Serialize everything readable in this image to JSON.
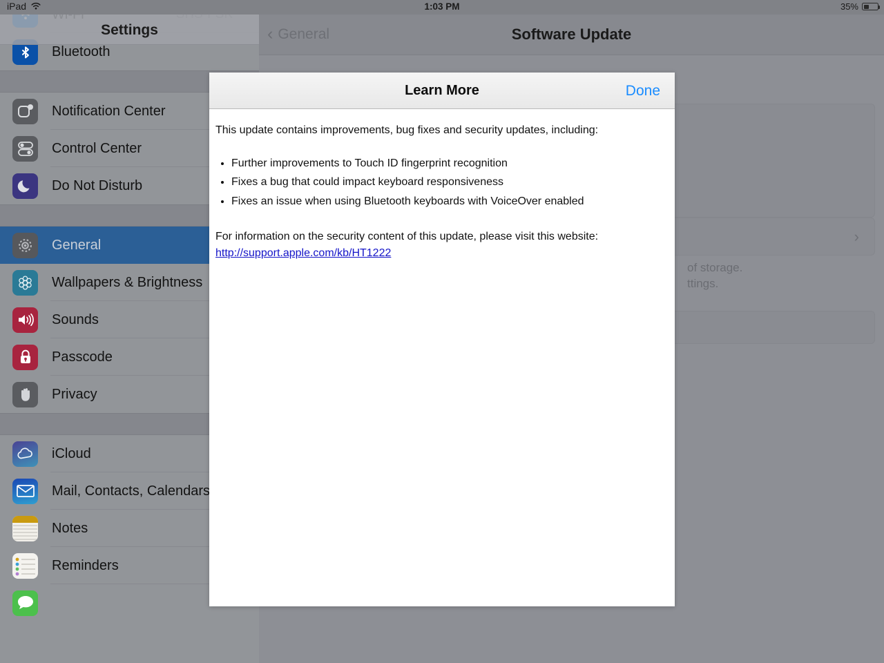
{
  "status_bar": {
    "device_label": "iPad",
    "wifi_icon": "wifi-icon",
    "time": "1:03 PM",
    "battery_percent": "35%",
    "battery_level": 35
  },
  "sidebar": {
    "title": "Settings",
    "groups": [
      {
        "items": [
          {
            "label": "Wi-Fi",
            "value": "SHS-FSK",
            "icon": "wifi-icon",
            "icon_style": "ic-wifi",
            "selected": false,
            "partial": true
          },
          {
            "label": "Bluetooth",
            "value": "",
            "icon": "bluetooth-icon",
            "icon_style": "ic-bt",
            "selected": false,
            "partial": false
          }
        ]
      },
      {
        "items": [
          {
            "label": "Notification Center",
            "value": "",
            "icon": "notification-center-icon",
            "icon_style": "ic-gray",
            "selected": false,
            "partial": false
          },
          {
            "label": "Control Center",
            "value": "",
            "icon": "control-center-icon",
            "icon_style": "ic-gray",
            "selected": false,
            "partial": false
          },
          {
            "label": "Do Not Disturb",
            "value": "",
            "icon": "moon-icon",
            "icon_style": "ic-purple",
            "selected": false,
            "partial": false
          }
        ]
      },
      {
        "items": [
          {
            "label": "General",
            "value": "",
            "icon": "gear-icon",
            "icon_style": "ic-gear",
            "selected": true,
            "partial": false
          },
          {
            "label": "Wallpapers & Brightness",
            "value": "",
            "icon": "wallpaper-icon",
            "icon_style": "ic-teal",
            "selected": false,
            "partial": false
          },
          {
            "label": "Sounds",
            "value": "",
            "icon": "speaker-icon",
            "icon_style": "ic-crimson",
            "selected": false,
            "partial": false
          },
          {
            "label": "Passcode",
            "value": "",
            "icon": "lock-icon",
            "icon_style": "ic-crimson",
            "selected": false,
            "partial": false
          },
          {
            "label": "Privacy",
            "value": "",
            "icon": "hand-icon",
            "icon_style": "ic-gray",
            "selected": false,
            "partial": false
          }
        ]
      },
      {
        "items": [
          {
            "label": "iCloud",
            "value": "",
            "icon": "cloud-icon",
            "icon_style": "ic-icloud",
            "selected": false,
            "partial": false
          },
          {
            "label": "Mail, Contacts, Calendars",
            "value": "",
            "icon": "mail-icon",
            "icon_style": "ic-mail",
            "selected": false,
            "partial": false
          },
          {
            "label": "Notes",
            "value": "",
            "icon": "notes-icon",
            "icon_style": "ic-notes",
            "selected": false,
            "partial": false
          },
          {
            "label": "Reminders",
            "value": "",
            "icon": "reminders-icon",
            "icon_style": "ic-reminders",
            "selected": false,
            "partial": false
          },
          {
            "label": "",
            "value": "",
            "icon": "messages-icon",
            "icon_style": "ic-green",
            "selected": false,
            "partial": true
          }
        ]
      }
    ]
  },
  "detail": {
    "back_label": "General",
    "back_icon": "chevron-left-icon",
    "title": "Software Update",
    "footer_line_1": "of storage.",
    "footer_line_2": "ttings.",
    "row_chevron_icon": "chevron-right-icon"
  },
  "modal": {
    "title": "Learn More",
    "done_label": "Done",
    "intro": "This update contains improvements, bug fixes and security updates, including:",
    "bullets": [
      "Further improvements to Touch ID fingerprint recognition",
      "Fixes a bug that could impact keyboard responsiveness",
      "Fixes an issue when using Bluetooth keyboards with VoiceOver enabled"
    ],
    "outro": "For information on the security content of this update, please visit this website:",
    "link_text": "http://support.apple.com/kb/HT1222"
  },
  "colors": {
    "accent_blue": "#1a8cff",
    "selected_row": "#2b5f96",
    "link": "#1414c8",
    "sidebar_bg": "#929599",
    "detail_bg": "#8d8f95"
  }
}
